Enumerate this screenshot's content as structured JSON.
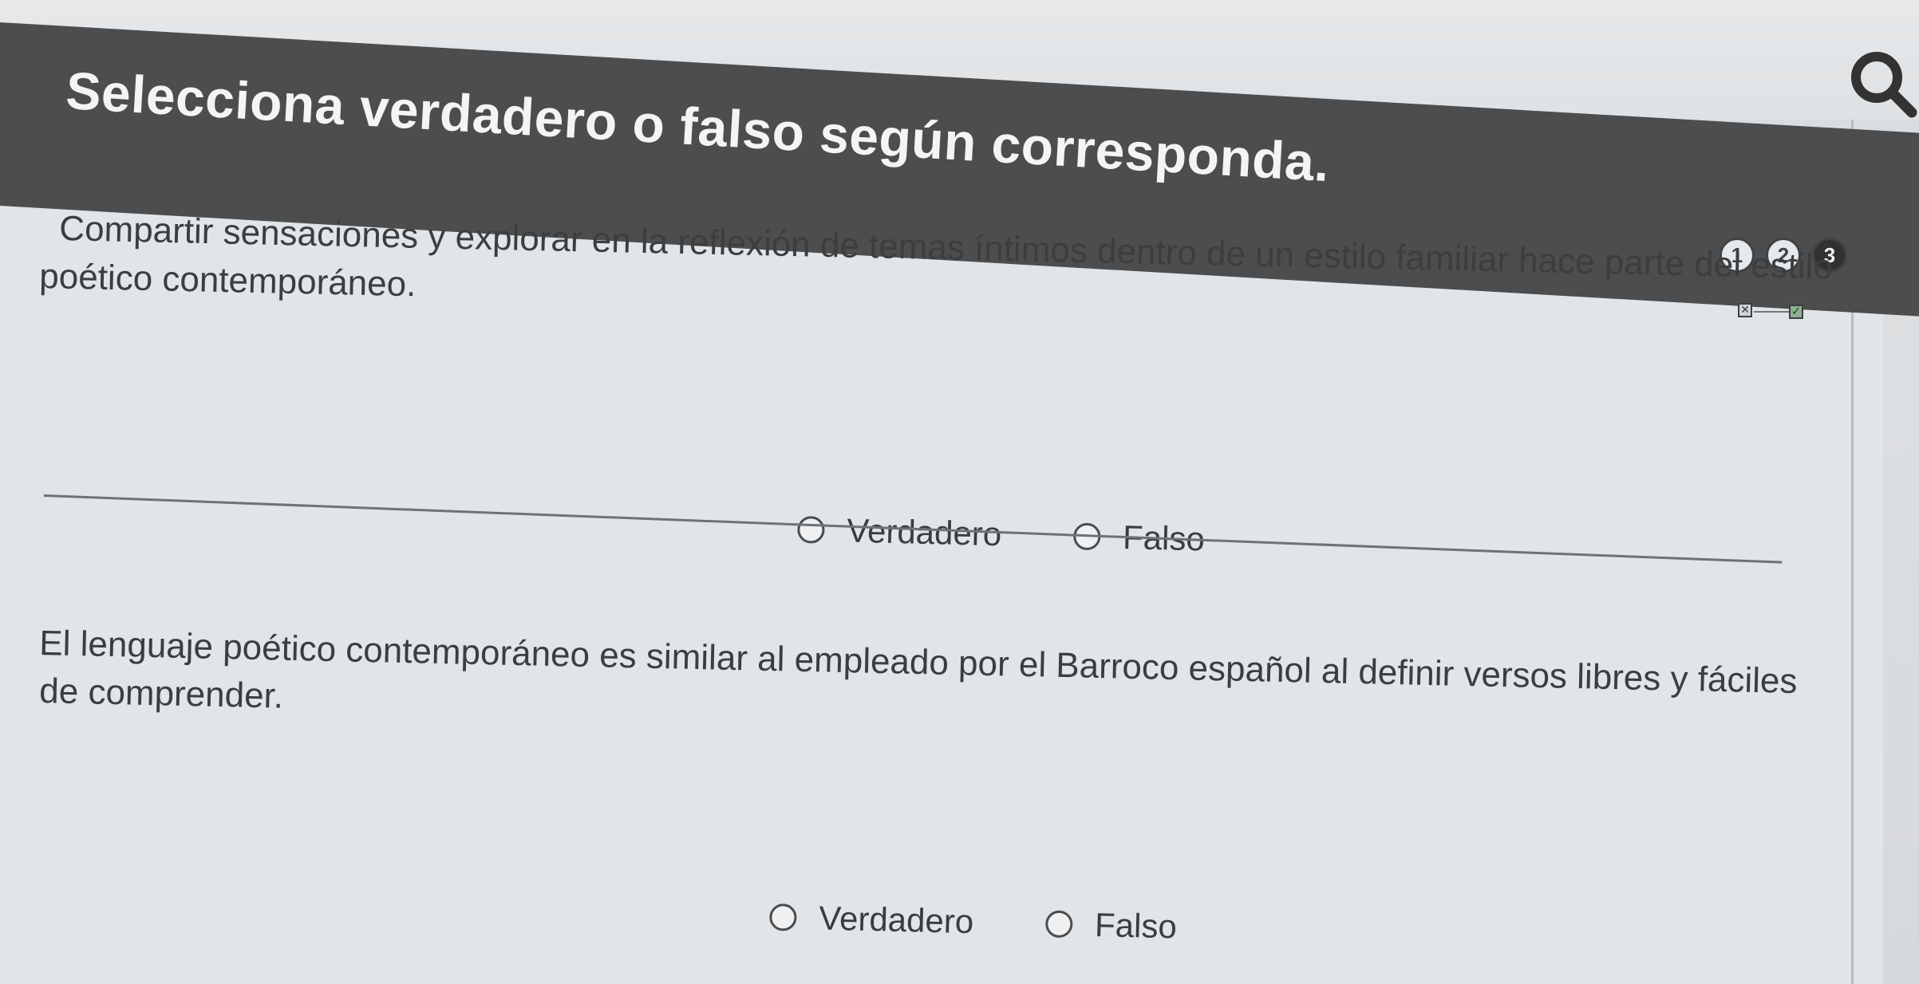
{
  "header": {
    "title": "Selecciona verdadero o falso según corresponda."
  },
  "steps": {
    "items": [
      "1",
      "2",
      "3"
    ],
    "active_index": 2,
    "marks": [
      "✕",
      "✓"
    ]
  },
  "questions": [
    {
      "text_line1": "Compartir sensaciones y explorar en la reflexión de temas íntimos dentro de un estilo familiar hace parte del estilo",
      "text_line2": "poético contemporáneo.",
      "option_true": "Verdadero",
      "option_false": "Falso"
    },
    {
      "text_line1": "El lenguaje poético contemporáneo es similar al empleado por el Barroco español al definir versos libres y fáciles",
      "text_line2": "de comprender.",
      "option_true": "Verdadero",
      "option_false": "Falso"
    }
  ],
  "colors": {
    "header_bg": "#4b4d4f",
    "page_bg": "#e2e5e7",
    "text": "#3c3d3e",
    "correct_mark": "#8bb08d"
  },
  "icons": {
    "search": "search-icon"
  }
}
